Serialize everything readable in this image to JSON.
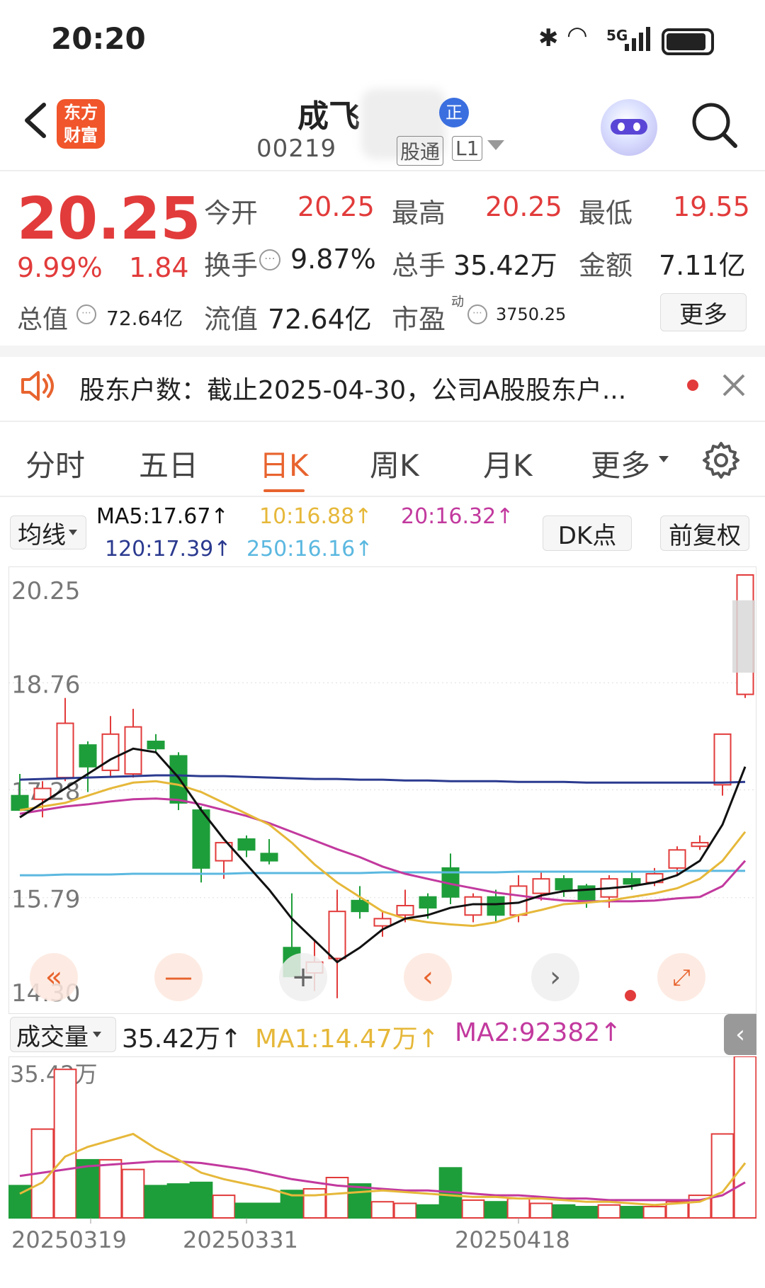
{
  "status_bar": {
    "time": "20:20",
    "network": "5G"
  },
  "header": {
    "app_logo_text": "东方财富",
    "stock_name": "成飞",
    "stock_code": "00219",
    "tag_hk": "股通",
    "tag_level": "L1",
    "badge": "正"
  },
  "quote": {
    "price": "20.25",
    "change_pct": "9.99%",
    "change_amt": "1.84",
    "open_label": "今开",
    "open": "20.25",
    "high_label": "最高",
    "high": "20.25",
    "low_label": "最低",
    "low": "19.55",
    "turnover_label": "换手",
    "turnover": "9.87%",
    "volume_label": "总手",
    "volume": "35.42万",
    "amount_label": "金额",
    "amount": "7.11亿",
    "total_mv_label": "总值",
    "total_mv": "72.64亿",
    "float_mv_label": "流值",
    "float_mv": "72.64亿",
    "pe_label": "市盈",
    "pe_sup": "动",
    "pe": "3750.25",
    "more_button": "更多"
  },
  "notice": {
    "text": "股东户数：截止2025-04-30，公司A股股东户..."
  },
  "tabs": [
    {
      "label": "分时"
    },
    {
      "label": "五日"
    },
    {
      "label": "日K"
    },
    {
      "label": "周K"
    },
    {
      "label": "月K"
    },
    {
      "label": "更多"
    }
  ],
  "ma_bar": {
    "selector": "均线",
    "ma5": "MA5:17.67↑",
    "ma10": "10:16.88↑",
    "ma20": "20:16.32↑",
    "ma120": "120:17.39↑",
    "ma250": "250:16.16↑",
    "dk_button": "DK点",
    "adjust_button": "前复权"
  },
  "colors": {
    "up": "#e23b3b",
    "down": "#1e9e3a",
    "accent": "#e8632e",
    "ma5": "#111111",
    "ma10": "#e6b83a",
    "ma20": "#c2399e",
    "ma120": "#2b3a8f",
    "ma250": "#5bb8e0"
  },
  "volume_bar": {
    "selector": "成交量",
    "value": "35.42万↑",
    "ma1": "MA1:14.47万↑",
    "ma2": "MA2:92382↑"
  },
  "chart_data": {
    "type": "candlestick",
    "y_ticks": [
      "20.25",
      "18.76",
      "17.28",
      "15.79",
      "14.30"
    ],
    "ylim": [
      14.3,
      20.25
    ],
    "volume_max_label": "35.42万",
    "x_ticks": [
      "20250319",
      "20250331",
      "20250418"
    ],
    "candles": [
      {
        "o": 17.2,
        "h": 17.5,
        "l": 17.05,
        "c": 17.0
      },
      {
        "o": 17.15,
        "h": 17.4,
        "l": 16.9,
        "c": 17.3
      },
      {
        "o": 17.45,
        "h": 18.55,
        "l": 17.4,
        "c": 18.2
      },
      {
        "o": 17.9,
        "h": 17.95,
        "l": 17.25,
        "c": 17.6
      },
      {
        "o": 17.55,
        "h": 18.3,
        "l": 17.45,
        "c": 18.05
      },
      {
        "o": 17.5,
        "h": 18.4,
        "l": 17.45,
        "c": 18.15
      },
      {
        "o": 17.95,
        "h": 18.05,
        "l": 17.8,
        "c": 17.85
      },
      {
        "o": 17.75,
        "h": 17.8,
        "l": 17.0,
        "c": 17.1
      },
      {
        "o": 17.0,
        "h": 17.05,
        "l": 16.0,
        "c": 16.2
      },
      {
        "o": 16.3,
        "h": 16.55,
        "l": 16.05,
        "c": 16.55
      },
      {
        "o": 16.6,
        "h": 16.65,
        "l": 16.35,
        "c": 16.45
      },
      {
        "o": 16.4,
        "h": 16.6,
        "l": 16.25,
        "c": 16.3
      },
      {
        "o": 15.1,
        "h": 15.85,
        "l": 14.8,
        "c": 14.7
      },
      {
        "o": 14.75,
        "h": 15.2,
        "l": 14.5,
        "c": 14.9
      },
      {
        "o": 14.95,
        "h": 15.9,
        "l": 14.4,
        "c": 15.6
      },
      {
        "o": 15.75,
        "h": 15.95,
        "l": 15.5,
        "c": 15.6
      },
      {
        "o": 15.4,
        "h": 15.6,
        "l": 15.25,
        "c": 15.5
      },
      {
        "o": 15.55,
        "h": 15.9,
        "l": 15.45,
        "c": 15.68
      },
      {
        "o": 15.8,
        "h": 15.85,
        "l": 15.5,
        "c": 15.65
      },
      {
        "o": 16.2,
        "h": 16.4,
        "l": 15.7,
        "c": 15.8
      },
      {
        "o": 15.55,
        "h": 15.85,
        "l": 15.45,
        "c": 15.8
      },
      {
        "o": 15.8,
        "h": 15.9,
        "l": 15.45,
        "c": 15.55
      },
      {
        "o": 15.55,
        "h": 16.1,
        "l": 15.45,
        "c": 15.95
      },
      {
        "o": 15.85,
        "h": 16.15,
        "l": 15.75,
        "c": 16.05
      },
      {
        "o": 16.05,
        "h": 16.1,
        "l": 15.8,
        "c": 15.9
      },
      {
        "o": 15.95,
        "h": 15.98,
        "l": 15.65,
        "c": 15.75
      },
      {
        "o": 15.8,
        "h": 16.1,
        "l": 15.65,
        "c": 16.05
      },
      {
        "o": 16.05,
        "h": 16.15,
        "l": 15.9,
        "c": 15.98
      },
      {
        "o": 16.0,
        "h": 16.2,
        "l": 15.95,
        "c": 16.12
      },
      {
        "o": 16.2,
        "h": 16.5,
        "l": 16.1,
        "c": 16.45
      },
      {
        "o": 16.5,
        "h": 16.65,
        "l": 16.45,
        "c": 16.55
      },
      {
        "o": 17.35,
        "h": 18.05,
        "l": 17.2,
        "c": 18.05
      },
      {
        "o": 18.6,
        "h": 20.25,
        "l": 18.55,
        "c": 20.25
      }
    ],
    "ma5": [
      16.9,
      17.1,
      17.3,
      17.5,
      17.7,
      17.85,
      17.8,
      17.45,
      17.0,
      16.6,
      16.25,
      15.9,
      15.5,
      15.2,
      14.9,
      15.1,
      15.35,
      15.5,
      15.55,
      15.65,
      15.7,
      15.7,
      15.72,
      15.82,
      15.88,
      15.9,
      15.92,
      15.95,
      16.0,
      16.1,
      16.3,
      16.8,
      17.6
    ],
    "ma10": [
      17.0,
      17.05,
      17.1,
      17.2,
      17.3,
      17.38,
      17.4,
      17.35,
      17.25,
      17.1,
      16.95,
      16.8,
      16.55,
      16.25,
      16.0,
      15.8,
      15.6,
      15.5,
      15.45,
      15.42,
      15.4,
      15.45,
      15.55,
      15.62,
      15.7,
      15.72,
      15.75,
      15.8,
      15.85,
      15.92,
      16.05,
      16.3,
      16.7
    ],
    "ma20": [
      16.95,
      17.0,
      17.05,
      17.08,
      17.12,
      17.15,
      17.16,
      17.14,
      17.08,
      17.0,
      16.92,
      16.82,
      16.7,
      16.58,
      16.46,
      16.35,
      16.22,
      16.12,
      16.05,
      15.98,
      15.92,
      15.86,
      15.82,
      15.78,
      15.75,
      15.74,
      15.74,
      15.74,
      15.75,
      15.78,
      15.8,
      15.95,
      16.3
    ],
    "ma120": [
      17.42,
      17.43,
      17.44,
      17.45,
      17.46,
      17.47,
      17.48,
      17.48,
      17.47,
      17.47,
      17.46,
      17.45,
      17.44,
      17.43,
      17.43,
      17.42,
      17.42,
      17.41,
      17.41,
      17.4,
      17.4,
      17.4,
      17.39,
      17.39,
      17.39,
      17.38,
      17.38,
      17.38,
      17.38,
      17.38,
      17.38,
      17.38,
      17.39
    ],
    "ma250": [
      16.1,
      16.1,
      16.11,
      16.11,
      16.11,
      16.12,
      16.12,
      16.12,
      16.12,
      16.12,
      16.13,
      16.13,
      16.13,
      16.13,
      16.13,
      16.13,
      16.14,
      16.14,
      16.14,
      16.14,
      16.14,
      16.14,
      16.15,
      16.15,
      16.15,
      16.15,
      16.15,
      16.15,
      16.15,
      16.16,
      16.16,
      16.16,
      16.16
    ],
    "volume": [
      0.2,
      0.55,
      0.92,
      0.36,
      0.36,
      0.3,
      0.2,
      0.21,
      0.22,
      0.14,
      0.09,
      0.09,
      0.17,
      0.18,
      0.25,
      0.21,
      0.1,
      0.09,
      0.08,
      0.31,
      0.11,
      0.1,
      0.12,
      0.09,
      0.08,
      0.07,
      0.08,
      0.07,
      0.07,
      0.1,
      0.14,
      0.52,
      1.0
    ],
    "vol_ma1": [
      0.15,
      0.22,
      0.38,
      0.44,
      0.48,
      0.52,
      0.43,
      0.36,
      0.28,
      0.24,
      0.21,
      0.18,
      0.14,
      0.14,
      0.15,
      0.16,
      0.17,
      0.16,
      0.15,
      0.14,
      0.13,
      0.13,
      0.12,
      0.12,
      0.11,
      0.1,
      0.1,
      0.09,
      0.08,
      0.09,
      0.1,
      0.16,
      0.34
    ],
    "vol_ma2": [
      0.26,
      0.28,
      0.3,
      0.32,
      0.33,
      0.34,
      0.35,
      0.35,
      0.34,
      0.32,
      0.3,
      0.27,
      0.24,
      0.22,
      0.2,
      0.19,
      0.18,
      0.17,
      0.17,
      0.16,
      0.15,
      0.14,
      0.14,
      0.13,
      0.12,
      0.12,
      0.11,
      0.11,
      0.11,
      0.11,
      0.11,
      0.14,
      0.22
    ]
  }
}
